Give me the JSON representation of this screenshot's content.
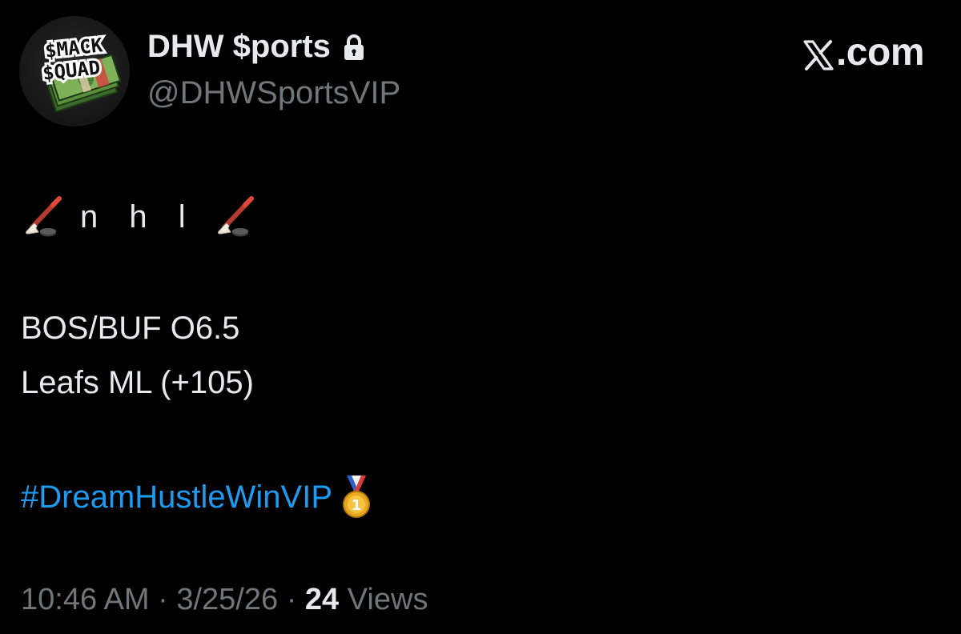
{
  "brand": {
    "label": ".com",
    "icon": "x-logo-icon"
  },
  "author": {
    "display_name": "DHW $ports",
    "handle": "@DHWSportsVIP",
    "avatar_text": [
      "$MACK",
      "$QUAD"
    ],
    "verified_icon": "lock-icon"
  },
  "tweet": {
    "nhl_text": "n h l",
    "lines": [
      "BOS/BUF O6.5",
      "Leafs ML (+105)"
    ],
    "hashtag": "#DreamHustleWinVIP",
    "emoji_icons": [
      "hockey-stick-icon",
      "medal-icon"
    ]
  },
  "meta": {
    "time": "10:46 AM",
    "sep": "·",
    "date": "3/25/26",
    "views_count": "24",
    "views_label": "Views"
  },
  "colors": {
    "background": "#000000",
    "text": "#e7e9ea",
    "muted": "#71767b",
    "link": "#1d9bf0"
  }
}
